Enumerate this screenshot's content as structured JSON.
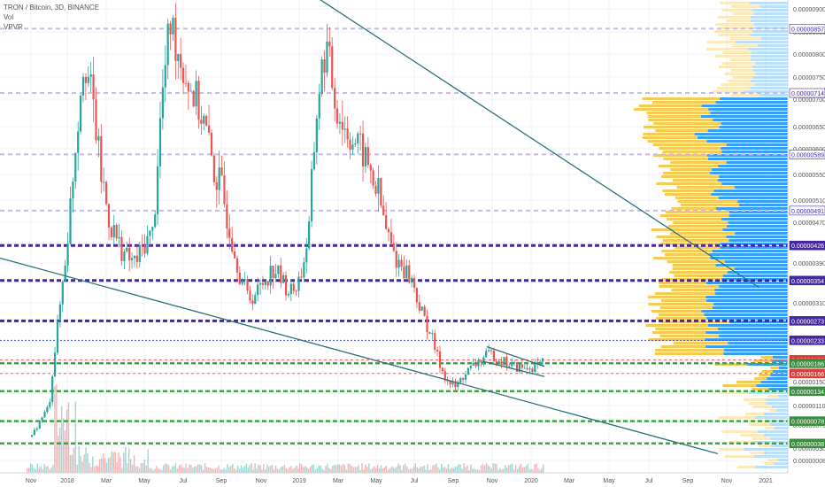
{
  "legend": {
    "title": "TRON / Bitcoin, 3D, BINANCE",
    "vol": "Vol",
    "vpvr": "VPVR"
  },
  "colors": {
    "up": "#26a69a",
    "down": "#ef5350",
    "vpvr_up": "#2196f3",
    "vpvr_down": "#f6c343",
    "trendline": "#2a7079",
    "level_purple_light": "#c9b8ea",
    "level_purple_dark": "#4527a0",
    "level_blue": "#3f51b5",
    "level_green": "#43a047",
    "level_red": "#ef5350",
    "label_purple_light": "#ffffff",
    "label_purple_dark": "#4527a0",
    "label_green": "#388e3c",
    "label_red": "#e53935"
  },
  "chart_data": {
    "type": "candlestick",
    "symbol": "TRON / Bitcoin",
    "interval": "3D",
    "exchange": "BINANCE",
    "y_axis": {
      "min": 5e-08,
      "max": 9.3e-07,
      "ticks": [
        "0.00000900",
        "0.00000850",
        "0.00000800",
        "0.00000750",
        "0.00000700",
        "0.00000650",
        "0.00000600",
        "0.00000550",
        "0.00000510",
        "0.00000470",
        "0.00000430",
        "0.00000390",
        "0.00000350",
        "0.00000310",
        "0.00000270",
        "0.00000230",
        "0.00000190",
        "0.00000150",
        "0.00000110",
        "0.00000070",
        "0.00000030",
        "0.00000008"
      ],
      "tick_values": [
        9e-07,
        8.5e-07,
        8e-07,
        7.5e-07,
        7e-07,
        6.5e-07,
        6e-07,
        5.5e-07,
        5.1e-07,
        4.7e-07,
        4.3e-07,
        3.9e-07,
        3.5e-07,
        3.1e-07,
        2.7e-07,
        2.3e-07,
        1.9e-07,
        1.5e-07,
        1.1e-07,
        7e-08,
        3e-08,
        8e-09
      ]
    },
    "x_axis": {
      "labels": [
        "Nov",
        "2018",
        "Mar",
        "May",
        "Jul",
        "Sep",
        "Nov",
        "2019",
        "Mar",
        "May",
        "Jul",
        "Sep",
        "Nov",
        "2020",
        "Mar",
        "May",
        "Jul",
        "Sep",
        "Nov",
        "2021"
      ]
    },
    "horizontal_levels": [
      {
        "label": "0.00000857",
        "value": 8.57e-07,
        "style": "purple_light"
      },
      {
        "label": "0.00000714",
        "value": 7.14e-07,
        "style": "purple_light"
      },
      {
        "label": "0.00000589",
        "value": 5.89e-07,
        "style": "purple_light"
      },
      {
        "label": "0.00000491",
        "value": 4.91e-07,
        "style": "purple_light"
      },
      {
        "label": "0.00000426",
        "value": 4.26e-07,
        "style": "purple_dark"
      },
      {
        "label": "0.00000354",
        "value": 3.54e-07,
        "style": "purple_dark"
      },
      {
        "label": "0.00000273",
        "value": 2.73e-07,
        "style": "purple_dark"
      },
      {
        "label": "0.00000233",
        "value": 2.33e-07,
        "style": "blue"
      },
      {
        "label": "0.00000193",
        "value": 1.93e-07,
        "style": "red"
      },
      {
        "label": "0.00000186",
        "value": 1.86e-07,
        "style": "green"
      },
      {
        "label": "0.00000166",
        "value": 1.66e-07,
        "style": "red"
      },
      {
        "label": "0.00000134",
        "value": 1.34e-07,
        "style": "green"
      },
      {
        "label": "0.00000078",
        "value": 7.8e-08,
        "style": "green"
      },
      {
        "label": "0.00000038",
        "value": 3.8e-08,
        "style": "green"
      }
    ],
    "price_series": [
      [
        0,
        5e-08
      ],
      [
        2,
        1.1e-07
      ],
      [
        4,
        4.2e-07
      ],
      [
        5,
        6e-07
      ],
      [
        6,
        8e-07
      ],
      [
        7,
        7e-07
      ],
      [
        8,
        5.5e-07
      ],
      [
        9,
        4.7e-07
      ],
      [
        10,
        4.3e-07
      ],
      [
        11,
        4e-07
      ],
      [
        12,
        3.9e-07
      ],
      [
        13,
        4.3e-07
      ],
      [
        14,
        4.5e-07
      ],
      [
        15,
        7e-07
      ],
      [
        16,
        8.7e-07
      ],
      [
        17,
        8e-07
      ],
      [
        18,
        7.4e-07
      ],
      [
        19,
        7e-07
      ],
      [
        20,
        6.5e-07
      ],
      [
        21,
        5.6e-07
      ],
      [
        22,
        5.2e-07
      ],
      [
        23,
        4.5e-07
      ],
      [
        24,
        3.7e-07
      ],
      [
        25,
        3.2e-07
      ],
      [
        26,
        3.3e-07
      ],
      [
        27,
        3.6e-07
      ],
      [
        28,
        3.8e-07
      ],
      [
        29,
        3.5e-07
      ],
      [
        30,
        3.3e-07
      ],
      [
        31,
        3.6e-07
      ],
      [
        32,
        4.5e-07
      ],
      [
        33,
        7e-07
      ],
      [
        34,
        8.2e-07
      ],
      [
        35,
        7e-07
      ],
      [
        36,
        6.5e-07
      ],
      [
        37,
        6.2e-07
      ],
      [
        38,
        6e-07
      ],
      [
        39,
        5.6e-07
      ],
      [
        40,
        5.2e-07
      ],
      [
        41,
        4.5e-07
      ],
      [
        42,
        4e-07
      ],
      [
        43,
        3.8e-07
      ],
      [
        44,
        3.5e-07
      ],
      [
        45,
        2.9e-07
      ],
      [
        46,
        2.5e-07
      ],
      [
        47,
        1.9e-07
      ],
      [
        48,
        1.5e-07
      ],
      [
        49,
        1.4e-07
      ],
      [
        50,
        1.65e-07
      ],
      [
        51,
        1.8e-07
      ],
      [
        52,
        1.95e-07
      ],
      [
        53,
        2.05e-07
      ],
      [
        54,
        1.95e-07
      ],
      [
        55,
        1.85e-07
      ],
      [
        56,
        1.78e-07
      ],
      [
        57,
        1.75e-07
      ],
      [
        58,
        1.8e-07
      ],
      [
        59,
        1.86e-07
      ]
    ],
    "trendlines": [
      {
        "from": [
          0.32,
          1e-06
        ],
        "to": [
          0.92,
          3.4e-07
        ]
      },
      {
        "from": [
          0.0,
          4e-07
        ],
        "to": [
          0.87,
          2e-08
        ]
      },
      {
        "from": [
          0.59,
          2.2e-07
        ],
        "to": [
          0.66,
          1.8e-07
        ]
      },
      {
        "from": [
          0.585,
          1.9e-07
        ],
        "to": [
          0.66,
          1.6e-07
        ]
      }
    ]
  }
}
